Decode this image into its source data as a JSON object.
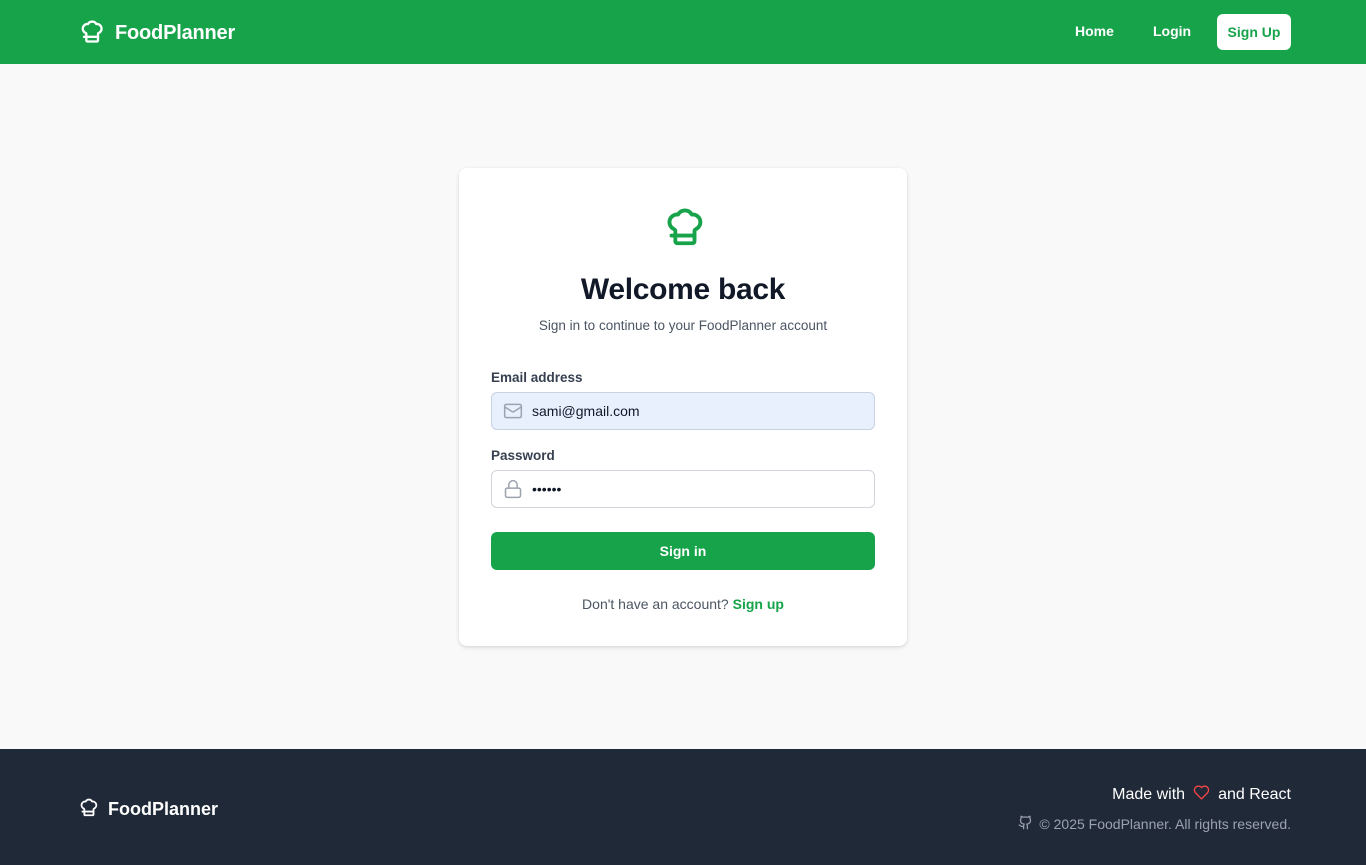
{
  "navbar": {
    "brand": "FoodPlanner",
    "links": [
      "Home",
      "Login"
    ],
    "signup_label": "Sign Up"
  },
  "login": {
    "title": "Welcome back",
    "subtitle": "Sign in to continue to your FoodPlanner account",
    "email_label": "Email address",
    "email_value": "sami@gmail.com",
    "password_label": "Password",
    "password_value": "••••••",
    "submit_label": "Sign in",
    "no_account_text": "Don't have an account?",
    "signup_link": "Sign up"
  },
  "footer": {
    "brand": "FoodPlanner",
    "made_with_prefix": "Made with",
    "made_with_suffix": "and React",
    "copyright": "© 2025 FoodPlanner. All rights reserved."
  },
  "icons": {
    "brand": "chef-hat-icon",
    "email": "mail-icon",
    "password": "lock-icon",
    "heart": "heart-icon",
    "github": "github-icon"
  },
  "colors": {
    "primary": "#16a34a",
    "footer_bg": "#1f2937",
    "page_bg": "#f9f9f9",
    "heart": "#ef4444"
  }
}
